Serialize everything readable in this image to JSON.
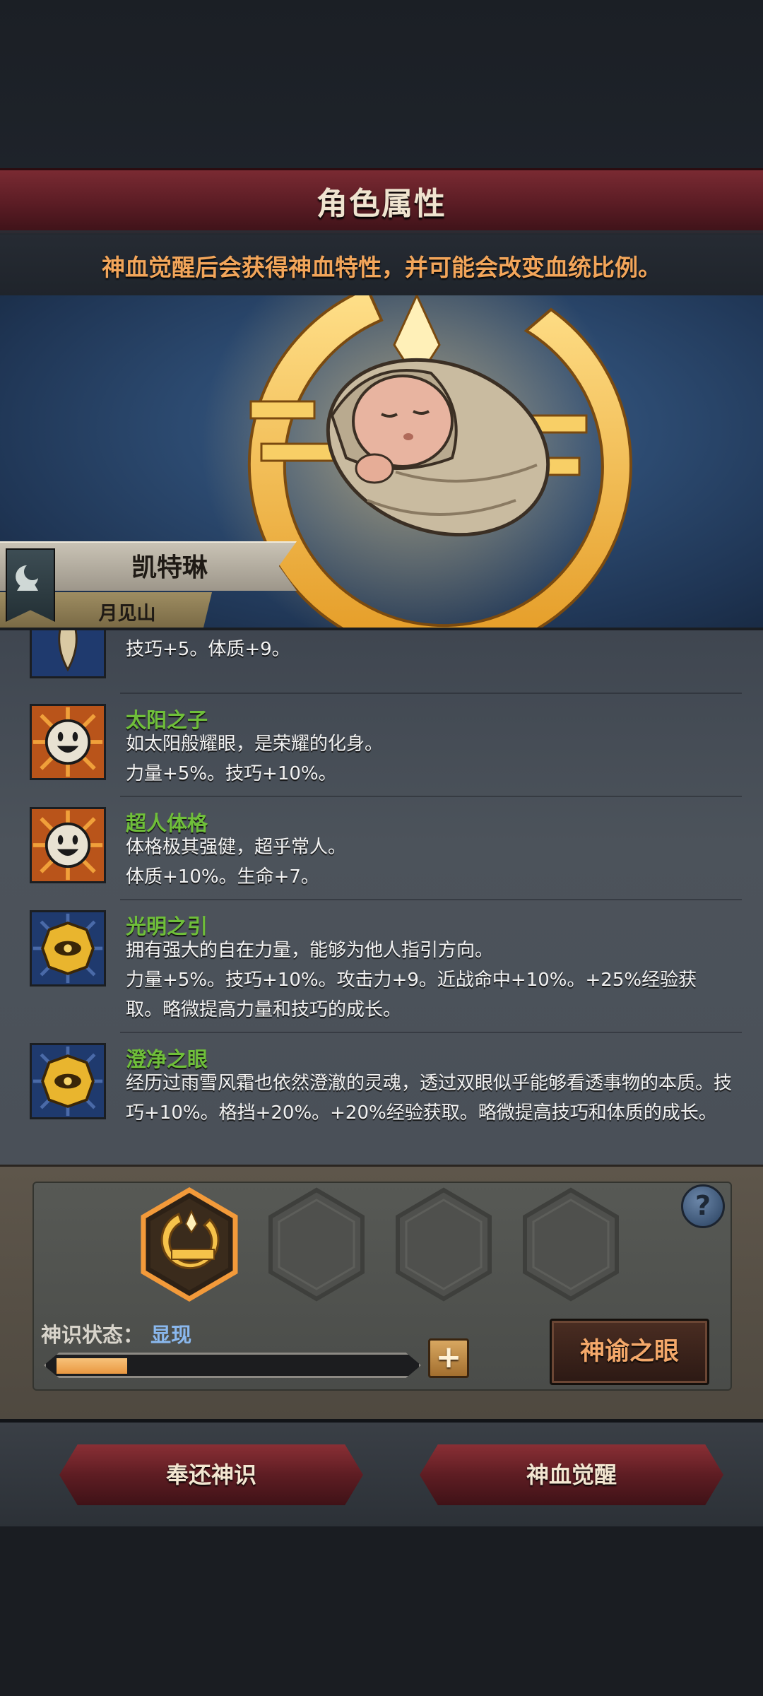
{
  "header": {
    "title": "角色属性",
    "hint": "神血觉醒后会获得神血特性，并可能会改变血统比例。"
  },
  "character": {
    "name": "凯特琳",
    "origin": "月见山"
  },
  "traits": [
    {
      "name": "",
      "description": "技巧+5。体质+9。",
      "icon": "feather-icon"
    },
    {
      "name": "太阳之子",
      "description": "如太阳般耀眼，是荣耀的化身。\n力量+5%。技巧+10%。",
      "icon": "smiley-sun-icon"
    },
    {
      "name": "超人体格",
      "description": "体格极其强健，超乎常人。\n体质+10%。生命+7。",
      "icon": "smiley-sun-icon"
    },
    {
      "name": "光明之引",
      "description": "拥有强大的自在力量，能够为他人指引方向。\n力量+5%。技巧+10%。攻击力+9。近战命中+10%。+25%经验获取。略微提高力量和技巧的成长。",
      "icon": "golden-eye-emblem-icon"
    },
    {
      "name": "澄净之眼",
      "description": "经历过雨雪风霜也依然澄澈的灵魂，透过双眼似乎能够看透事物的本质。技巧+10%。格挡+20%。+20%经验获取。略微提高技巧和体质的成长。",
      "icon": "golden-eye-emblem-icon"
    }
  ],
  "divine_sense": {
    "label": "神识状态：",
    "value": "显现",
    "progress": 0.2,
    "plus_label": "+",
    "oracle_button": "神谕之眼",
    "help_label": "?"
  },
  "slots": [
    {
      "filled": true,
      "icon": "moon-crest-icon"
    },
    {
      "filled": false
    },
    {
      "filled": false
    },
    {
      "filled": false
    }
  ],
  "actions": {
    "return_label": "奉还神识",
    "awaken_label": "神血觉醒"
  },
  "colors": {
    "title_bar": "#6a2229",
    "hint_text": "#f2a55a",
    "trait_name": "#6fbf3a",
    "status_value": "#8ab8ee",
    "oracle_text": "#f4a86a",
    "emblem_gold": "#f5b93c"
  }
}
